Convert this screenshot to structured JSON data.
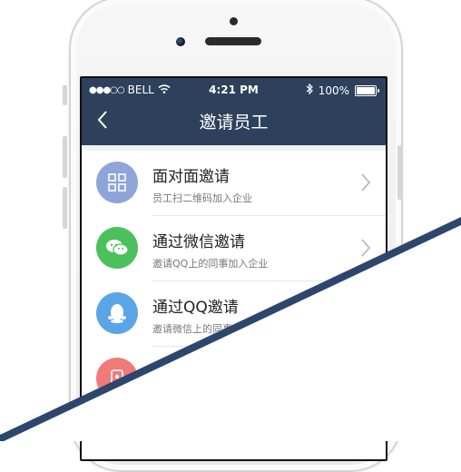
{
  "status_bar": {
    "carrier": "BELL",
    "time": "4:21 PM",
    "battery": "100%"
  },
  "nav": {
    "title": "邀请员工"
  },
  "items": [
    {
      "title": "面对面邀请",
      "subtitle": "员工扫二维码加入企业",
      "icon": "qr-code-icon",
      "color": "#8fa4d9"
    },
    {
      "title": "通过微信邀请",
      "subtitle": "邀请QQ上的同事加入企业",
      "icon": "wechat-icon",
      "color": "#4cc05a"
    },
    {
      "title": "通过QQ邀请",
      "subtitle": "邀请微信上的同事",
      "icon": "qq-icon",
      "color": "#5aa5e6"
    },
    {
      "title": "",
      "subtitle": "",
      "icon": "contacts-icon",
      "color": "#f07a78"
    }
  ],
  "colors": {
    "navbar": "#2d415c",
    "band": "#2d466e"
  }
}
